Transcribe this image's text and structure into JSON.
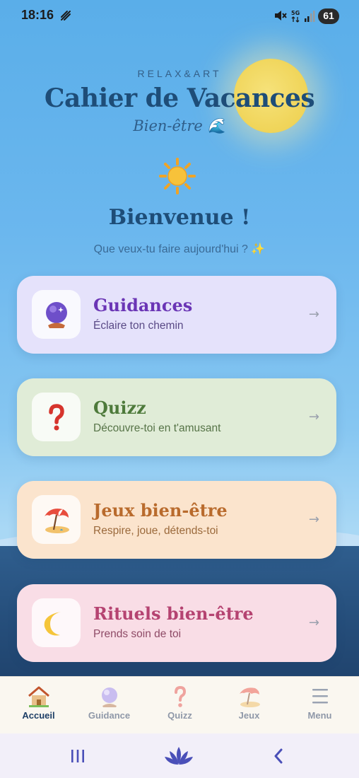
{
  "status_bar": {
    "time": "18:16",
    "battery": "61"
  },
  "header": {
    "brand": "RELAX&ART",
    "title": "Cahier de Vacances",
    "subtitle": "Bien-être 🌊",
    "welcome": "Bienvenue !",
    "question": "Que veux-tu faire aujourd'hui ? ✨"
  },
  "cards": [
    {
      "title": "Guidances",
      "subtitle": "Éclaire ton chemin",
      "icon": "crystal-ball-icon",
      "arrow": "→"
    },
    {
      "title": "Quizz",
      "subtitle": "Découvre-toi en t'amusant",
      "icon": "question-mark-icon",
      "arrow": "→"
    },
    {
      "title": "Jeux bien-être",
      "subtitle": "Respire, joue, détends-toi",
      "icon": "beach-umbrella-icon",
      "arrow": "→"
    },
    {
      "title": "Rituels bien-être",
      "subtitle": "Prends soin de toi",
      "icon": "crescent-moon-icon",
      "arrow": "→"
    }
  ],
  "tabs": [
    {
      "label": "Accueil",
      "icon": "house-icon",
      "active": true
    },
    {
      "label": "Guidance",
      "icon": "crystal-ball-icon"
    },
    {
      "label": "Quizz",
      "icon": "question-mark-icon"
    },
    {
      "label": "Jeux",
      "icon": "beach-umbrella-icon"
    },
    {
      "label": "Menu",
      "icon": "hamburger-icon"
    }
  ],
  "system_nav": {
    "recents_icon": "recents-icon",
    "home_icon": "lotus-icon",
    "back_icon": "back-icon"
  },
  "colors": {
    "title": "#1e4d78",
    "sea": "#264f7c",
    "sun": "#f0d55a",
    "active_tab": "#1e3f66"
  }
}
